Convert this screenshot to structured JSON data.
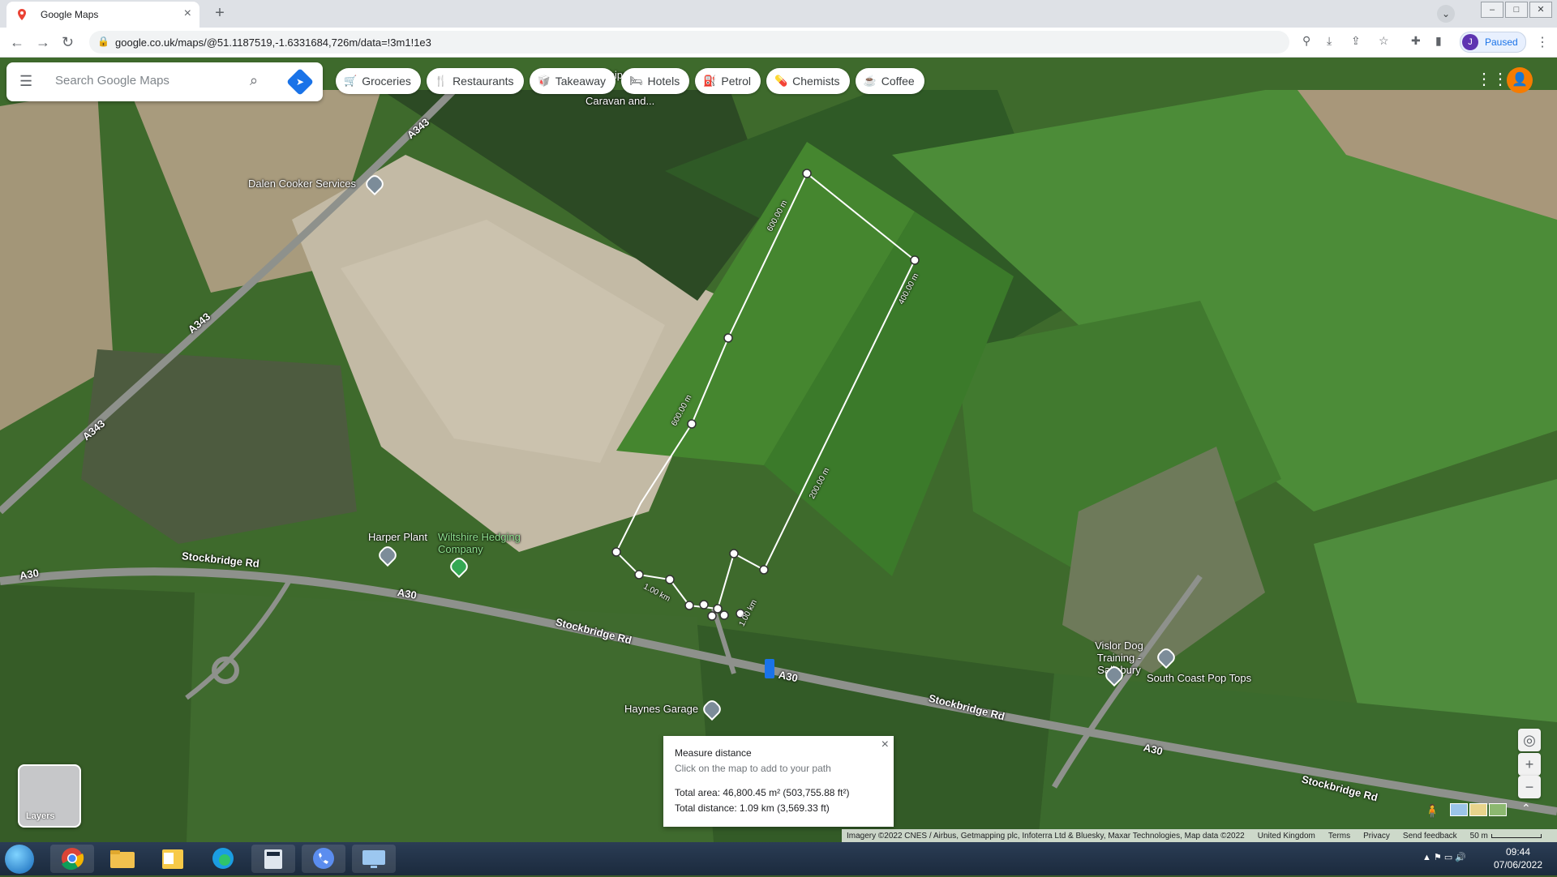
{
  "browser": {
    "tab_title": "Google Maps",
    "tab_close": "×",
    "new_tab": "+",
    "url": "google.co.uk/maps/@51.1187519,-1.6331684,726m/data=!3m1!1e3",
    "profile_initial": "J",
    "profile_status": "Paused"
  },
  "search": {
    "placeholder": "Search Google Maps"
  },
  "chips": [
    {
      "label": "Groceries",
      "icon": "cart-icon",
      "glyph": "🛒"
    },
    {
      "label": "Restaurants",
      "icon": "fork-knife-icon",
      "glyph": "🍴"
    },
    {
      "label": "Takeaway",
      "icon": "takeaway-icon",
      "glyph": "🥡"
    },
    {
      "label": "Hotels",
      "icon": "bed-icon",
      "glyph": "🛏"
    },
    {
      "label": "Petrol",
      "icon": "fuel-icon",
      "glyph": "⛽"
    },
    {
      "label": "Chemists",
      "icon": "pharmacy-icon",
      "glyph": "💊"
    },
    {
      "label": "Coffee",
      "icon": "coffee-icon",
      "glyph": "☕"
    }
  ],
  "map_labels": {
    "dalen": "Dalen Cooker Services",
    "harper": "Harper Plant",
    "wiltshire": "Wiltshire Hedging Company",
    "haynes": "Haynes Garage",
    "vislor": "Vislor Dog Training - Salisbury",
    "southcoast": "South Coast Pop Tops",
    "caravan": "Caravan and...",
    "phipson": "Phipson"
  },
  "road_labels": {
    "a343": "A343",
    "a30": "A30",
    "stockbridge": "Stockbridge Rd"
  },
  "segment_labels": {
    "s600a": "600.00 m",
    "s600b": "600.00 m",
    "s400": "400.00 m",
    "s200": "200.00 m",
    "s100a": "1.00 km",
    "s100b": "1.00 km"
  },
  "measure": {
    "heading": "Measure distance",
    "hint": "Click on the map to add to your path",
    "area": "Total area: 46,800.45 m² (503,755.88 ft²)",
    "distance": "Total distance: 1.09 km (3,569.33 ft)",
    "close": "×"
  },
  "layers_label": "Layers",
  "controls": {
    "zoom_in": "+",
    "zoom_out": "−",
    "locate": "◎"
  },
  "footer": {
    "imagery": "Imagery ©2022 CNES / Airbus, Getmapping plc, Infoterra Ltd & Bluesky, Maxar Technologies, Map data ©2022",
    "region": "United Kingdom",
    "terms": "Terms",
    "privacy": "Privacy",
    "feedback": "Send feedback",
    "scale": "50 m"
  },
  "taskbar": {
    "time": "09:44",
    "date": "07/06/2022"
  },
  "colors": {
    "accent": "#1a73e8",
    "field_green": "#3f7a2c",
    "path_white": "#ffffff"
  }
}
